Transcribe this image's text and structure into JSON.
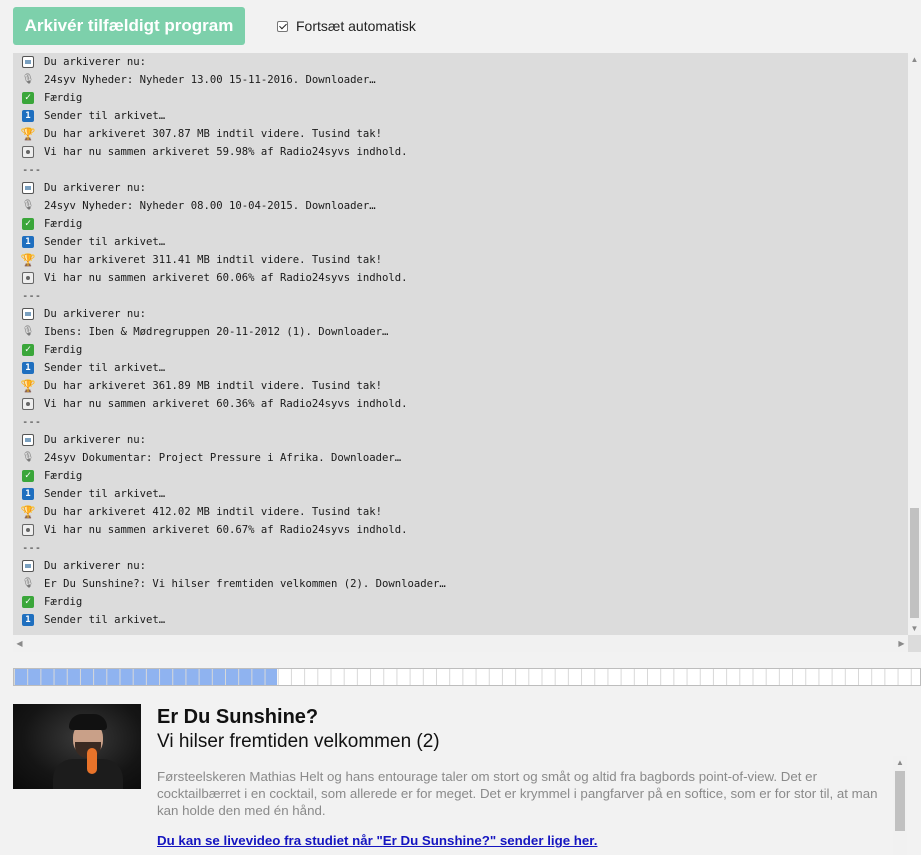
{
  "toolbar": {
    "archive_button": "Arkivér tilfældigt program",
    "auto_continue_label": "Fortsæt automatisk",
    "auto_continue_checked": true
  },
  "log": {
    "entries": [
      {
        "type": "line",
        "icon": "tv-icon",
        "text": "Du arkiverer nu:"
      },
      {
        "type": "line",
        "icon": "microphone-icon",
        "text": "24syv Nyheder: Nyheder 13.00 15-11-2016. Downloader…"
      },
      {
        "type": "line",
        "icon": "check-icon",
        "text": "Færdig"
      },
      {
        "type": "line",
        "icon": "number-one-icon",
        "text": "Sender til arkivet…"
      },
      {
        "type": "line",
        "icon": "trophy-icon",
        "text": "Du har arkiveret 307.87 MB indtil videre. Tusind tak!"
      },
      {
        "type": "line",
        "icon": "radio-icon",
        "text": "Vi har nu sammen arkiveret 59.98% af Radio24syvs indhold."
      },
      {
        "type": "sep",
        "text": "---"
      },
      {
        "type": "line",
        "icon": "tv-icon",
        "text": "Du arkiverer nu:"
      },
      {
        "type": "line",
        "icon": "microphone-icon",
        "text": "24syv Nyheder: Nyheder 08.00 10-04-2015. Downloader…"
      },
      {
        "type": "line",
        "icon": "check-icon",
        "text": "Færdig"
      },
      {
        "type": "line",
        "icon": "number-one-icon",
        "text": "Sender til arkivet…"
      },
      {
        "type": "line",
        "icon": "trophy-icon",
        "text": "Du har arkiveret 311.41 MB indtil videre. Tusind tak!"
      },
      {
        "type": "line",
        "icon": "radio-icon",
        "text": "Vi har nu sammen arkiveret 60.06% af Radio24syvs indhold."
      },
      {
        "type": "sep",
        "text": "---"
      },
      {
        "type": "line",
        "icon": "tv-icon",
        "text": "Du arkiverer nu:"
      },
      {
        "type": "line",
        "icon": "microphone-icon",
        "text": "Ibens: Iben & Mødregruppen 20-11-2012 (1). Downloader…"
      },
      {
        "type": "line",
        "icon": "check-icon",
        "text": "Færdig"
      },
      {
        "type": "line",
        "icon": "number-one-icon",
        "text": "Sender til arkivet…"
      },
      {
        "type": "line",
        "icon": "trophy-icon",
        "text": "Du har arkiveret 361.89 MB indtil videre. Tusind tak!"
      },
      {
        "type": "line",
        "icon": "radio-icon",
        "text": "Vi har nu sammen arkiveret 60.36% af Radio24syvs indhold."
      },
      {
        "type": "sep",
        "text": "---"
      },
      {
        "type": "line",
        "icon": "tv-icon",
        "text": "Du arkiverer nu:"
      },
      {
        "type": "line",
        "icon": "microphone-icon",
        "text": "24syv Dokumentar: Project Pressure i Afrika. Downloader…"
      },
      {
        "type": "line",
        "icon": "check-icon",
        "text": "Færdig"
      },
      {
        "type": "line",
        "icon": "number-one-icon",
        "text": "Sender til arkivet…"
      },
      {
        "type": "line",
        "icon": "trophy-icon",
        "text": "Du har arkiveret 412.02 MB indtil videre. Tusind tak!"
      },
      {
        "type": "line",
        "icon": "radio-icon",
        "text": "Vi har nu sammen arkiveret 60.67% af Radio24syvs indhold."
      },
      {
        "type": "sep",
        "text": "---"
      },
      {
        "type": "line",
        "icon": "tv-icon",
        "text": "Du arkiverer nu:"
      },
      {
        "type": "line",
        "icon": "microphone-icon",
        "text": "Er Du Sunshine?: Vi hilser fremtiden velkommen (2). Downloader…"
      },
      {
        "type": "line",
        "icon": "check-icon",
        "text": "Færdig"
      },
      {
        "type": "line",
        "icon": "number-one-icon",
        "text": "Sender til arkivet…"
      }
    ]
  },
  "progress": {
    "fraction": 0.29
  },
  "program": {
    "title": "Er Du Sunshine?",
    "episode": "Vi hilser fremtiden velkommen (2)",
    "description": "Førsteelskeren Mathias Helt og hans entourage taler om stort og småt og altid fra bagbords point-of-view. Det er cocktailbærret i en cocktail, som allerede er for meget. Det er krymmel i pangfarver på en softice, som er for stor til, at man kan holde den med én hånd.",
    "live_link": "Du kan se livevideo fra studiet når \"Er Du Sunshine?\" sender lige her."
  },
  "colors": {
    "button_green": "#7dd0ab",
    "progress_blue": "#8fb3f0",
    "link_blue": "#1515c0"
  }
}
